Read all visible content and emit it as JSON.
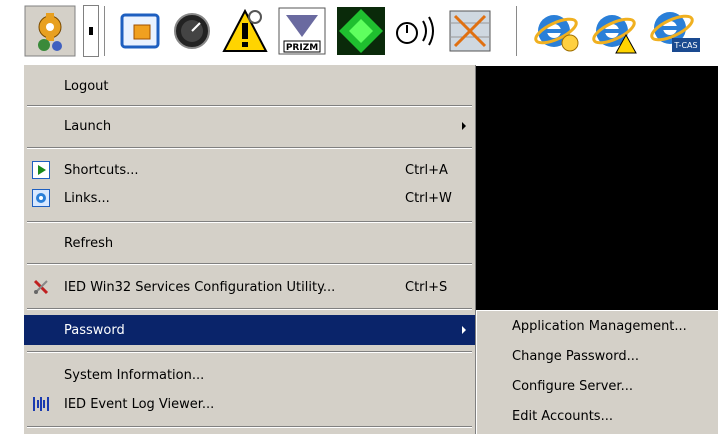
{
  "menu": {
    "items": [
      {
        "label": "Logout",
        "shortcut": "",
        "submenu": false
      },
      {
        "label": "Launch",
        "shortcut": "",
        "submenu": true
      },
      {
        "label": "Shortcuts...",
        "shortcut": "Ctrl+A",
        "submenu": false,
        "icon": "play-icon"
      },
      {
        "label": "Links...",
        "shortcut": "Ctrl+W",
        "submenu": false,
        "icon": "ie-icon"
      },
      {
        "label": "Refresh",
        "shortcut": "",
        "submenu": false
      },
      {
        "label": "IED Win32 Services Configuration Utility...",
        "shortcut": "Ctrl+S",
        "submenu": false,
        "icon": "tools-icon"
      },
      {
        "label": "Password",
        "shortcut": "",
        "submenu": true,
        "highlighted": true
      },
      {
        "label": "System Information...",
        "shortcut": "",
        "submenu": false
      },
      {
        "label": "IED Event Log Viewer...",
        "shortcut": "",
        "submenu": false,
        "icon": "event-log-icon"
      }
    ]
  },
  "submenu": {
    "items": [
      {
        "label": "Application Management..."
      },
      {
        "label": "Change Password..."
      },
      {
        "label": "Configure Server..."
      },
      {
        "label": "Edit Accounts..."
      }
    ]
  },
  "toolbar": {
    "icons": [
      "app-gear-icon",
      "dropdown-arrow-icon",
      "window-icon",
      "gauge-icon",
      "warning-lock-icon",
      "prizm-icon",
      "green-diamond-icon",
      "clock-sound-icon",
      "grid-x-icon",
      "ie-icon",
      "ie-warning-icon",
      "ie-tcas-icon"
    ],
    "prizm_text": "PRIZM",
    "tcas_text": "T-CAS"
  },
  "colors": {
    "menu_bg": "#d4d0c8",
    "highlight": "#0a246a"
  }
}
